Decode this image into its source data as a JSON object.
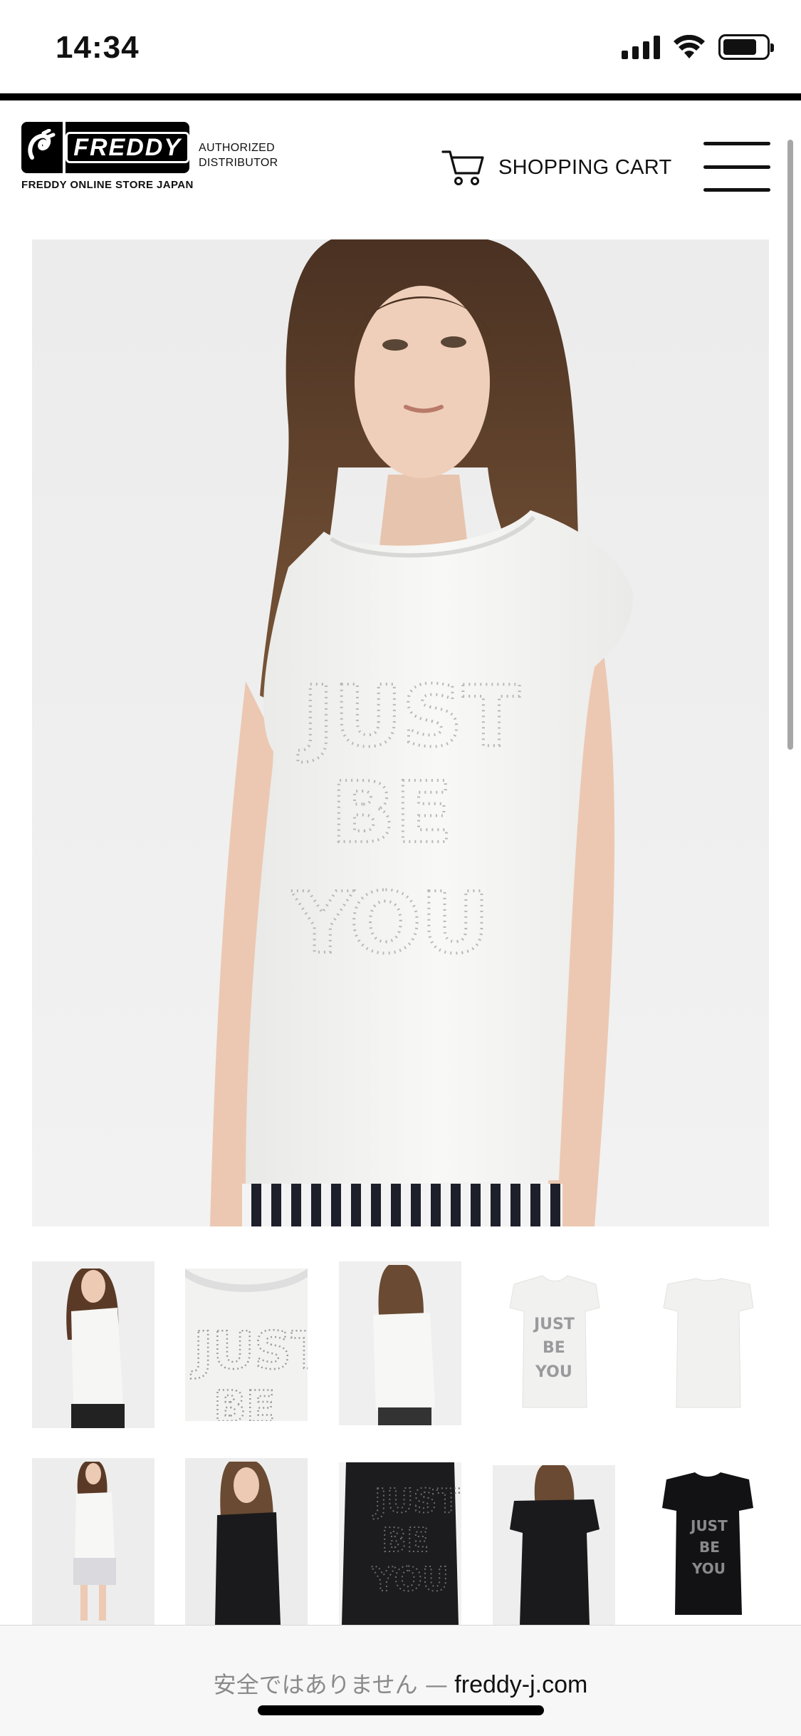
{
  "status_bar": {
    "time": "14:34"
  },
  "header": {
    "brand": "FREDDY",
    "tagline": "FREDDY ONLINE STORE JAPAN",
    "authorized_line1": "AUTHORIZED",
    "authorized_line2": "DISTRIBUTOR",
    "cart_label": "SHOPPING CART"
  },
  "product": {
    "hero_image": "white t-shirt with rhinestone slogan (model front view)",
    "print_text": [
      "JUST",
      "BE",
      "YOU"
    ]
  },
  "thumbnails": [
    "model-front-white",
    "detail-print-white",
    "model-back-white",
    "flat-front-white",
    "flat-back-white",
    "model-full-white",
    "model-front-black",
    "detail-print-black",
    "model-back-black",
    "flat-front-black"
  ],
  "browser": {
    "insecure_label": "安全ではありません —",
    "domain": "freddy-j.com"
  }
}
